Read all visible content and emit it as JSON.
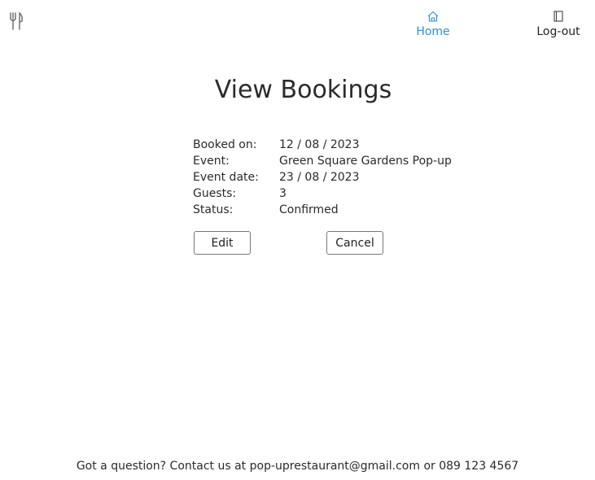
{
  "header": {
    "logo_icon": "fork-knife-icon",
    "nav": {
      "home": {
        "label": "Home",
        "icon": "home-icon",
        "color": "#2b8fd8"
      },
      "logout": {
        "label": "Log-out",
        "icon": "door-icon"
      }
    }
  },
  "main": {
    "title": "View Bookings",
    "booking": {
      "booked_on_label": "Booked on:",
      "booked_on_value": "12 / 08 / 2023",
      "event_label": "Event:",
      "event_value": "Green Square Gardens Pop-up",
      "event_date_label": "Event date:",
      "event_date_value": "23 / 08 / 2023",
      "guests_label": "Guests:",
      "guests_value": "3",
      "status_label": "Status:",
      "status_value": "Confirmed"
    },
    "actions": {
      "edit_label": "Edit",
      "cancel_label": "Cancel"
    }
  },
  "footer": {
    "text": "Got a question? Contact us at pop-uprestaurant@gmail.com or 089 123 4567"
  }
}
